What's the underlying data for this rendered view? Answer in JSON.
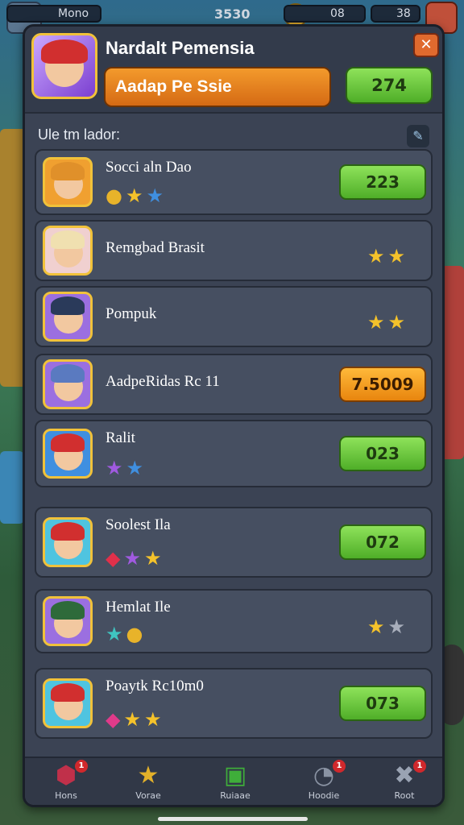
{
  "hud": {
    "left_label": "Mono",
    "score": "3530",
    "gold": "08",
    "gems": "38"
  },
  "panel": {
    "title": "Nardalt Pemensia",
    "banner": "Aadap Pe Ssie",
    "banner_value": "274",
    "subheading": "Ule tm lador:"
  },
  "list": [
    {
      "name": "Socci aln Dao",
      "icons": [
        "coin",
        "star-gold",
        "star-blue"
      ],
      "button": "223",
      "stars": []
    },
    {
      "name": "Remgbad Brasit",
      "icons": [],
      "button": "",
      "stars": [
        "star-gold",
        "star-gold"
      ]
    },
    {
      "name": "Pompuk",
      "icons": [],
      "button": "",
      "stars": [
        "star-gold",
        "star-gold"
      ]
    },
    {
      "name": "AadpeRidas Rc 11",
      "icons": [],
      "button": "7.5009",
      "button_style": "orange",
      "stars": []
    },
    {
      "name": "Ralit",
      "icons": [
        "star-purple",
        "star-blue"
      ],
      "button": "023",
      "stars": []
    },
    {
      "name": "Soolest Ila",
      "icons": [
        "gem-red",
        "star-purple",
        "star-gold"
      ],
      "button": "072",
      "stars": []
    },
    {
      "name": "Hemlat Ile",
      "icons": [
        "star-teal",
        "coin"
      ],
      "button": "",
      "stars": [
        "star-gold",
        "star-grey"
      ]
    },
    {
      "name": "Poaytk Rc10m0",
      "icons": [
        "gem-pink",
        "star-gold",
        "star-gold"
      ],
      "button": "073",
      "stars": []
    }
  ],
  "nav": [
    {
      "label": "Hons",
      "icon": "gem-icon",
      "badge": "1",
      "color": "#c0304a"
    },
    {
      "label": "Vorae",
      "icon": "star-icon",
      "badge": "",
      "color": "#e3b12a"
    },
    {
      "label": "Ruiaae",
      "icon": "shop-icon",
      "badge": "",
      "color": "#3fae3a"
    },
    {
      "label": "Hoodie",
      "icon": "clock-icon",
      "badge": "1",
      "color": "#8a93a3"
    },
    {
      "label": "Root",
      "icon": "tools-icon",
      "badge": "1",
      "color": "#9aa3b3"
    }
  ]
}
